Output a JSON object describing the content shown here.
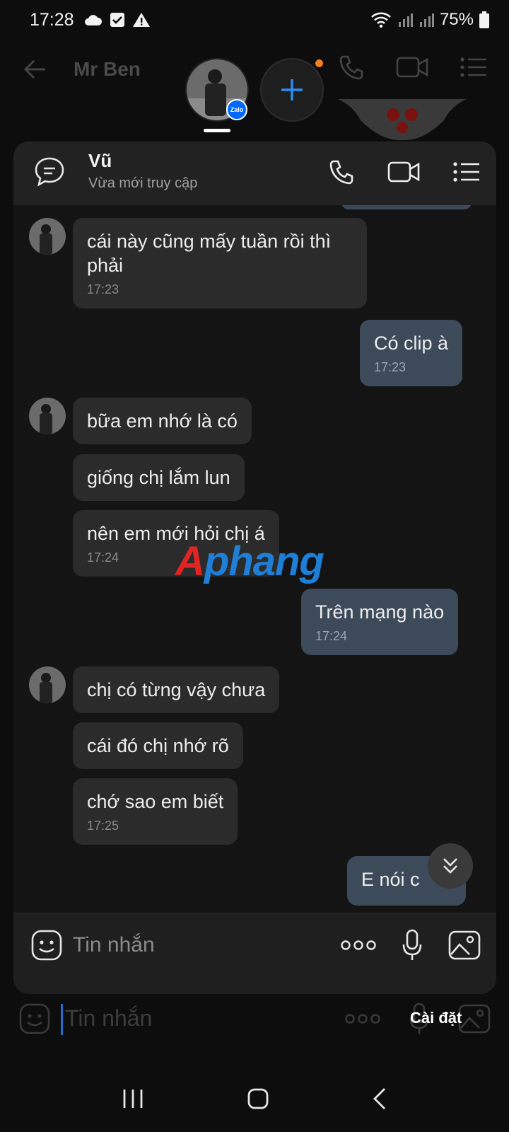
{
  "status_bar": {
    "time": "17:28",
    "battery": "75%"
  },
  "background_chat": {
    "title": "Mr Ben",
    "composer_placeholder": "Tin nhắn",
    "badge": "Zalo"
  },
  "chat_head": {
    "name": "Vũ",
    "status": "Vừa mới truy cập"
  },
  "messages": [
    {
      "dir": "in",
      "text": "cái này cũng mấy tuần rồi thì phải",
      "time": "17:23"
    },
    {
      "dir": "out",
      "text": "Có clip à",
      "time": "17:23"
    },
    {
      "dir": "in",
      "text": "bữa em nhớ là có",
      "time": ""
    },
    {
      "dir": "in",
      "text": "giống chị lắm lun",
      "time": ""
    },
    {
      "dir": "in",
      "text": "nên em mới hỏi chị á",
      "time": "17:24"
    },
    {
      "dir": "out",
      "text": "Trên mạng nào",
      "time": "17:24"
    },
    {
      "dir": "in",
      "text": "chị có từng vậy chưa",
      "time": ""
    },
    {
      "dir": "in",
      "text": "cái đó chị nhớ rõ",
      "time": ""
    },
    {
      "dir": "in",
      "text": "chớ sao em biết",
      "time": "17:25"
    },
    {
      "dir": "out",
      "text": "E nói c",
      "time": ""
    }
  ],
  "watermark": {
    "part1": "A",
    "part2": "phang"
  },
  "composer": {
    "placeholder": "Tin nhắn"
  },
  "popup": {
    "settings_label": "Cài đặt"
  },
  "colors": {
    "incoming_bubble": "#2b2b2b",
    "outgoing_bubble": "#3d4a5a",
    "accent_blue": "#1f7fd6",
    "notify_orange": "#f07f1e"
  },
  "icons": [
    "cloud-icon",
    "check-icon",
    "warning-icon",
    "wifi-icon",
    "signal-icon",
    "battery-icon",
    "back-arrow-icon",
    "phone-icon",
    "video-icon",
    "list-icon",
    "plus-icon",
    "chat-bubble-icon",
    "emoji-icon",
    "more-icon",
    "mic-icon",
    "image-icon",
    "chevron-double-down-icon",
    "recent-apps-icon",
    "home-icon",
    "back-icon"
  ]
}
